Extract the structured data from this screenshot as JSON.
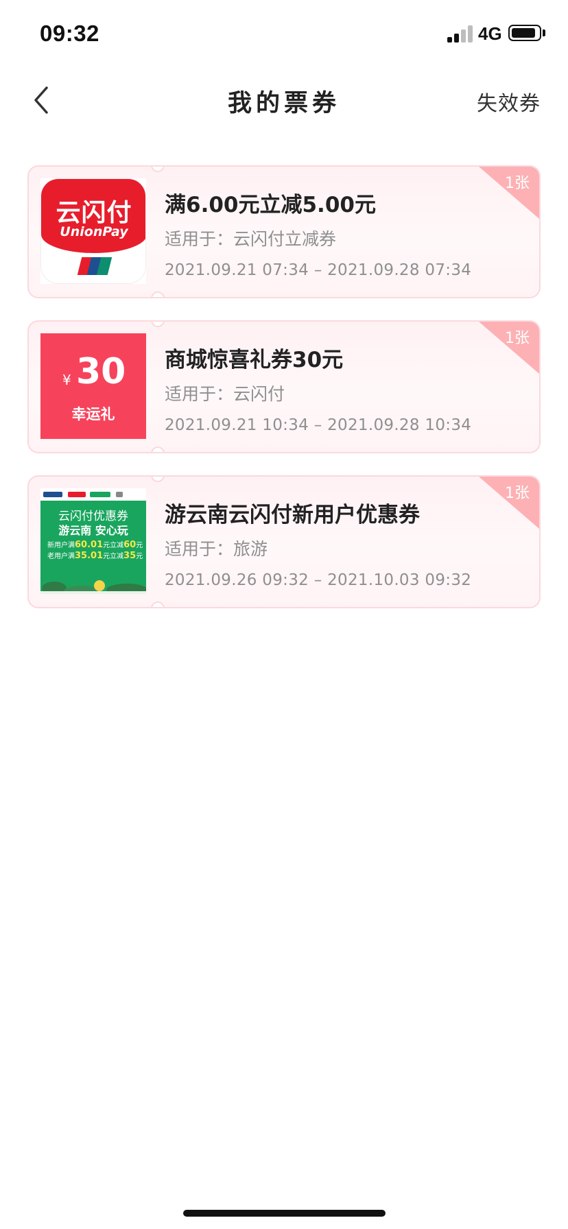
{
  "status_bar": {
    "time": "09:32",
    "network": "4G"
  },
  "header": {
    "title": "我的票券",
    "right_link": "失效券"
  },
  "coupons": [
    {
      "title": "满6.00元立减5.00元",
      "scope": "适用于：云闪付立减券",
      "date_range": "2021.09.21 07:34 – 2021.09.28 07:34",
      "count": "1张",
      "thumb": {
        "type": "unionpay-logo",
        "text_cn": "云闪付",
        "text_en": "UnionPay"
      }
    },
    {
      "title": "商城惊喜礼券30元",
      "scope": "适用于：云闪付",
      "date_range": "2021.09.21 10:34 – 2021.09.28 10:34",
      "count": "1张",
      "thumb": {
        "type": "lucky-gift",
        "currency": "¥",
        "amount": "30",
        "label": "幸运礼"
      }
    },
    {
      "title": "游云南云闪付新用户优惠券",
      "scope": "适用于：旅游",
      "date_range": "2021.09.26 09:32 – 2021.10.03 09:32",
      "count": "1张",
      "thumb": {
        "type": "yunnan-banner",
        "line1": "云闪付优惠券",
        "line2": "游云南 安心玩",
        "line3_prefix": "新用户满",
        "line3_threshold": "60.01",
        "line3_mid": "元立减",
        "line3_discount": "60",
        "line3_suffix": "元",
        "line4_prefix": "老用户满",
        "line4_threshold": "35.01",
        "line4_mid": "元立减",
        "line4_discount": "35",
        "line4_suffix": "元"
      }
    }
  ],
  "colors": {
    "accent_red": "#e71d2c",
    "gift_red": "#f6435b",
    "corner_pink": "#fdb1b4",
    "card_border": "#fbd9dd",
    "yunnan_green": "#19a55e",
    "secondary_text": "#8f8f8f"
  }
}
